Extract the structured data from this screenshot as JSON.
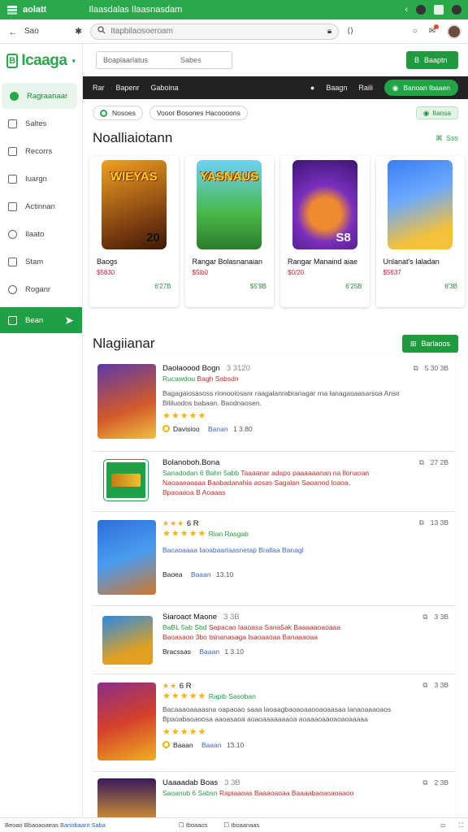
{
  "status_bar": {
    "app_name": "aolatt",
    "title": "Ilaasdalas  Ilaasnasdam"
  },
  "browser": {
    "back_label": "Sao",
    "url_placeholder": "Itapbilaosoeroam"
  },
  "sidebar": {
    "logo_text": "Icaaga",
    "items": [
      {
        "label": "Ragraanaar",
        "icon": "store-icon"
      },
      {
        "label": "Saltes",
        "icon": "building-icon"
      },
      {
        "label": "Recorrs",
        "icon": "folder-icon"
      },
      {
        "label": "Iuargn",
        "icon": "laptop-icon"
      },
      {
        "label": "Actinnan",
        "icon": "pin-icon"
      },
      {
        "label": "Ilaato",
        "icon": "compass-icon"
      },
      {
        "label": "Stam",
        "icon": "calendar-icon"
      },
      {
        "label": "Roganr",
        "icon": "settings-icon"
      },
      {
        "label": "Bean",
        "icon": "grid-icon"
      }
    ]
  },
  "search_row": {
    "seg_left": "Boaplaarlatus",
    "seg_right": "Sabes",
    "button": "Baaptn"
  },
  "dark_bar": {
    "left": [
      "Rar",
      "Bapenr",
      "Gaboina"
    ],
    "right_a": "Baagn",
    "right_b": "Raili",
    "pill": "Banoan Ibaaen"
  },
  "filters": {
    "chip_a": "Nosoes",
    "chip_b": "Vooor Bosones  Hacoooons",
    "chip_green": "Ilansa"
  },
  "featured": {
    "title": "Noalliaiotann",
    "see_all": "Sss",
    "cards": [
      {
        "art_text": "WIEYAS",
        "art_num": "20",
        "title": "Baogs",
        "price": "$5630",
        "meta": "6'27B"
      },
      {
        "art_text": "YASNAUS",
        "art_num": "",
        "title": "Rangar Bolasnanaian",
        "price": "$5ib0",
        "meta": "$5'9B"
      },
      {
        "art_text": "",
        "art_num": "S8",
        "title": "Rangar Manaind aiae",
        "price": "$0/20",
        "meta": "6'25B"
      },
      {
        "art_text": "",
        "art_num": "",
        "title": "Unlanat's Ialadan",
        "price": "$5637",
        "meta": "6'3B"
      }
    ]
  },
  "list_section": {
    "title": "Nlagiianar",
    "button": "Barlaoos",
    "rows": [
      {
        "title": "Daolaoood Bogn",
        "num": "3 3120",
        "tagline_g": "Rucawdou",
        "tagline_r": "Bagh Sabsdn",
        "desc": "Bagagaiosasoss rionooiosanr raagalanrabranagar rna lanagaoaasarsoa Ansir",
        "desc2": "Bililuodos babaan. Baodnaosen.",
        "stars": "★★★★★",
        "action": "5 30  3B",
        "foot_a": "Davisioo",
        "foot_b": "Banan",
        "foot_c": "1 3.80"
      },
      {
        "title": "Bolanoboh.Bona",
        "num": "",
        "tagline_g": "Sanadodan 6 Bahn 5abb",
        "tagline_r": "Taaaanar adapo paaaaaanan na Ilonaoan",
        "desc": "Naoaaeaasaa Baabadanahia aosas Sagalan Saoanod Ioaoa.",
        "desc2": "Bpaoaaoa  B Aoaaas",
        "stars": "",
        "action": "27 2B",
        "foot_a": "",
        "foot_b": "",
        "foot_c": ""
      },
      {
        "title": "6 R",
        "num": "",
        "tagline_g": "Rlan  Rasgab",
        "tagline_r": "",
        "desc": "Bacaoaaaa Iaoabaarlaasnetap Brallaa Banagl",
        "desc2": "",
        "stars": "★★★★★",
        "action": "13  3B",
        "foot_a": "Baoea",
        "foot_b": "Baaan",
        "foot_c": "13.10"
      },
      {
        "title": "Siaroaot Maone",
        "num": "3 3B",
        "tagline_g": "BaBL 5ab Sbd",
        "tagline_r": "Sapacao Iaaoasa Sana5ak Baaaaaoaoaaa",
        "desc": "Baoasaoo 3bo tsinanasaga Isaoaaoaa Banaaaoaa",
        "desc2": "",
        "stars": "",
        "action": "3  3B",
        "foot_a": "Bracssas",
        "foot_b": "Baaan",
        "foot_c": "1 3.10"
      },
      {
        "title": "6 R",
        "num": "",
        "tagline_g": "Rapib Sasoban",
        "tagline_r": "",
        "desc": "Bacaaaoaaaasna oapaoao saaa laoaagbaoaoaaooaoaasaa lanaoaaaoaos",
        "desc2": "Bpaoabaoaoosa aaoasaoa aoaoaaaaaaaoa aoaaaoaaoaoaoaaaaa",
        "stars": "★★★★★",
        "action": "3  3B",
        "foot_a": "Baaan",
        "foot_b": "Baaan",
        "foot_c": "13.10"
      },
      {
        "title": "Uaaaadab Boas",
        "num": "3 3B",
        "tagline_g": "Saoanob 6 Sabsn",
        "tagline_r": "Rapiaaoas Baaaoaoaa Baaaabaoaoaoaaoo",
        "desc": "",
        "desc2": "",
        "stars": "",
        "action": "2 3B",
        "foot_a": "",
        "foot_b": "",
        "foot_c": ""
      }
    ]
  },
  "bottom_bar": {
    "left": "Beoao Bbaoaoaeas",
    "link": "Banobaant Saba",
    "mid_a": "Iboaaos",
    "mid_b": "Iboaanaas"
  },
  "colors": {
    "brand_green": "#2aa84a",
    "dark_bar": "#222222",
    "price_red": "#c42b2b",
    "link_blue": "#3a67c9"
  }
}
